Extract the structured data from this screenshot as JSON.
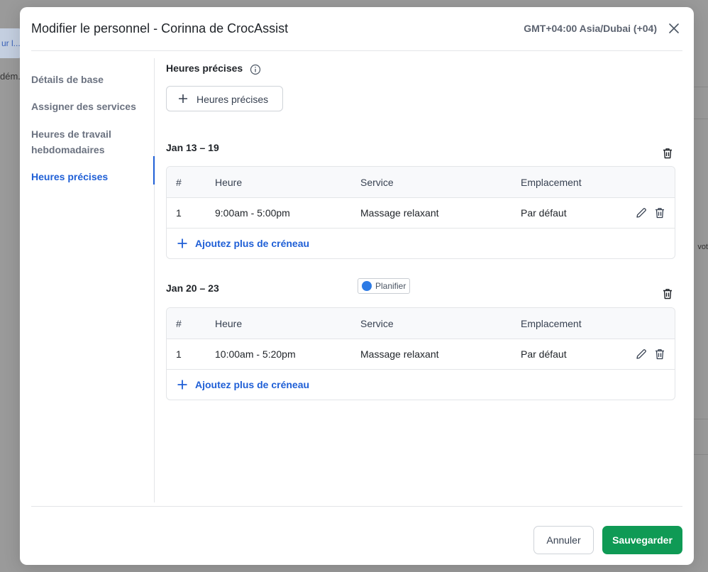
{
  "background": {
    "chip_text": "ur l...",
    "text1": "dém.",
    "text2": "vot"
  },
  "modal": {
    "title": "Modifier le personnel - Corinna de CrocAssist",
    "timezone": "GMT+04:00 Asia/Dubai (+04)"
  },
  "sidebar": {
    "items": [
      {
        "label": "Détails de base"
      },
      {
        "label": "Assigner des services"
      },
      {
        "label": "Heures de travail hebdomadaires"
      },
      {
        "label": "Heures précises"
      }
    ],
    "active_index": 3
  },
  "main": {
    "section_title": "Heures précises",
    "add_button_label": "Heures précises",
    "columns": [
      "#",
      "Heure",
      "Service",
      "Emplacement"
    ],
    "add_slot_label": "Ajoutez plus de créneau",
    "badge_label": "Planifier",
    "ranges": [
      {
        "label": "Jan 13 – 19",
        "rows": [
          {
            "num": "1",
            "time": "9:00am - 5:00pm",
            "service": "Massage relaxant",
            "location": "Par défaut"
          }
        ]
      },
      {
        "label": "Jan 20 – 23",
        "rows": [
          {
            "num": "1",
            "time": "10:00am - 5:20pm",
            "service": "Massage relaxant",
            "location": "Par défaut"
          }
        ]
      }
    ]
  },
  "footer": {
    "cancel_label": "Annuler",
    "save_label": "Sauvegarder"
  },
  "colors": {
    "accent": "#1f5fd6",
    "save": "#0f9a55"
  }
}
